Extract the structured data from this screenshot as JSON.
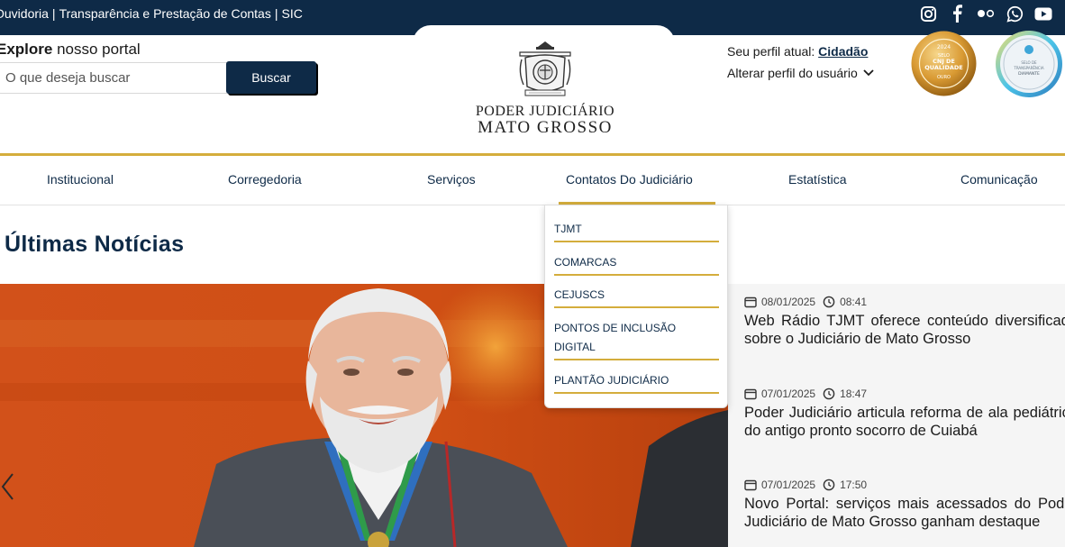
{
  "topbar": {
    "links": [
      "Ouvidoria",
      "Transparência e Prestação de Contas",
      "SIC"
    ],
    "separator": "|",
    "socials": [
      "instagram-icon",
      "facebook-icon",
      "flickr-icon",
      "whatsapp-icon",
      "youtube-icon"
    ],
    "bg_color": "#0e2a47"
  },
  "header": {
    "explore_bold": "Explore",
    "explore_rest": " nosso portal",
    "search_placeholder": "O que deseja buscar",
    "search_button": "Buscar",
    "brand_line1": "Poder Judiciário",
    "brand_line2": "Mato Grosso",
    "profile_label": "Seu perfil atual: ",
    "profile_value": "Cidadão",
    "profile_change": "Alterar perfil do usuário",
    "seal1_text": [
      "2024",
      "SELO",
      "CNJ DE",
      "QUALIDADE",
      "OURO"
    ],
    "seal2_text": [
      "SELO DE",
      "TRANSPARÊNCIA",
      "DIAMANTE"
    ]
  },
  "nav": {
    "items": [
      "Institucional",
      "Corregedoria",
      "Serviços",
      "Contatos Do Judiciário",
      "Estatística",
      "Comunicação"
    ],
    "active": "Contatos Do Judiciário",
    "accent_color": "#d4ad3c"
  },
  "dropdown": {
    "items": [
      "TJMT",
      "COMARCAS",
      "CEJUSCS",
      "PONTOS DE INCLUSÃO DIGITAL",
      "PLANTÃO JUDICIÁRIO"
    ]
  },
  "news": {
    "section_title": "Últimas Notícias",
    "items": [
      {
        "date": "08/01/2025",
        "time": "08:41",
        "title": "Web Rádio TJMT oferece conteúdo diversificado sobre o Judiciário de Mato Grosso"
      },
      {
        "date": "07/01/2025",
        "time": "18:47",
        "title": "Poder Judiciário articula reforma de ala pediátrica do antigo pronto socorro de Cuiabá"
      },
      {
        "date": "07/01/2025",
        "time": "17:50",
        "title": "Novo Portal: serviços mais acessados do Poder Judiciário de Mato Grosso ganham destaque"
      }
    ]
  }
}
